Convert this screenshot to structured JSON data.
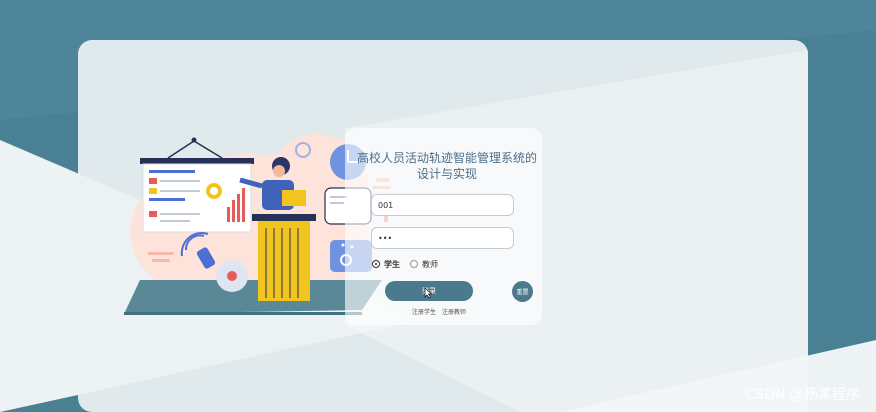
{
  "page": {
    "title": "高校人员活动轨迹智能管理系统的设计与实现"
  },
  "login_form": {
    "username_value": "001",
    "password_value": "•••",
    "roles": [
      {
        "label": "学生",
        "selected": true
      },
      {
        "label": "教师",
        "selected": false
      }
    ],
    "login_label": "登录",
    "reset_label": "重置",
    "links": [
      "注册学生",
      "注册教师"
    ]
  },
  "watermark": "CSDN @杨某程序",
  "colors": {
    "background": "#4a8094",
    "primary_button": "#4b7a8c",
    "title_text": "#4d6f8a"
  },
  "icons": [
    "presentation-board-icon",
    "clock-icon",
    "wifi-icon",
    "upload-arrow-icon",
    "mouse-cursor-icon"
  ]
}
